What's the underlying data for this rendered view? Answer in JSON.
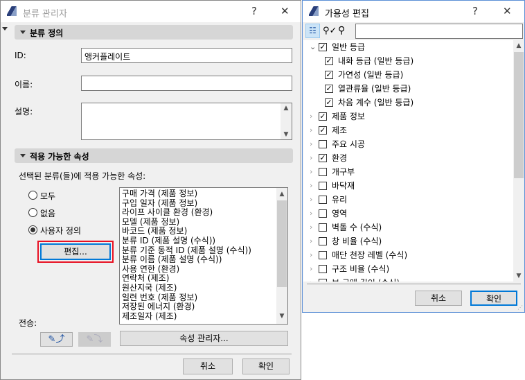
{
  "left": {
    "title": "분류 관리자",
    "help": "?",
    "close": "✕",
    "section1": "분류 정의",
    "id_label": "ID:",
    "id_value": "앵커플레이트",
    "name_label": "이름:",
    "name_value": "",
    "desc_label": "설명:",
    "desc_value": "",
    "section2": "적용 가능한 속성",
    "applicable_text": "선택된 분류(들)에 적용 가능한 속성:",
    "radios": [
      {
        "label": "모두",
        "checked": false
      },
      {
        "label": "없음",
        "checked": false
      },
      {
        "label": "사용자 정의",
        "checked": true
      }
    ],
    "edit_button": "편집...",
    "properties": [
      "구매 가격 (제품 정보)",
      "구입 일자 (제품 정보)",
      "라이프 사이클 환경 (환경)",
      "모델 (제품 정보)",
      "바코드 (제품 정보)",
      "분류 ID (제품 설명 (수식))",
      "분류 기준 동적 ID (제품 설명 (수식))",
      "분류 이름 (제품 설명 (수식))",
      "사용 연한 (환경)",
      "연락처 (제조)",
      "원산지국 (제조)",
      "일련 번호 (제품 정보)",
      "저장된 에너지 (환경)",
      "제조일자 (제조)"
    ],
    "transfer_label": "전송:",
    "property_manager_button": "속성 관리자...",
    "cancel": "취소",
    "ok": "확인"
  },
  "right": {
    "title": "가용성 편집",
    "help": "?",
    "close": "✕",
    "search_value": "",
    "items": [
      {
        "label": "일반 등급",
        "checked": true,
        "level": 0,
        "expander": "expanded"
      },
      {
        "label": "내화 등급 (일반 등급)",
        "checked": true,
        "level": 1,
        "expander": "none"
      },
      {
        "label": "가연성 (일반 등급)",
        "checked": true,
        "level": 1,
        "expander": "none"
      },
      {
        "label": "열관류율 (일반 등급)",
        "checked": true,
        "level": 1,
        "expander": "none"
      },
      {
        "label": "차음 계수 (일반 등급)",
        "checked": true,
        "level": 1,
        "expander": "none"
      },
      {
        "label": "제품 정보",
        "checked": true,
        "level": 0,
        "expander": "collapsed"
      },
      {
        "label": "제조",
        "checked": true,
        "level": 0,
        "expander": "collapsed"
      },
      {
        "label": "주요 시공",
        "checked": false,
        "level": 0,
        "expander": "collapsed"
      },
      {
        "label": "환경",
        "checked": true,
        "level": 0,
        "expander": "collapsed"
      },
      {
        "label": "개구부",
        "checked": false,
        "level": 0,
        "expander": "collapsed"
      },
      {
        "label": "바닥재",
        "checked": false,
        "level": 0,
        "expander": "collapsed"
      },
      {
        "label": "유리",
        "checked": false,
        "level": 0,
        "expander": "collapsed"
      },
      {
        "label": "영역",
        "checked": false,
        "level": 0,
        "expander": "collapsed"
      },
      {
        "label": "벽돌 수 (수식)",
        "checked": false,
        "level": 0,
        "expander": "collapsed"
      },
      {
        "label": "창 비율 (수식)",
        "checked": false,
        "level": 0,
        "expander": "collapsed"
      },
      {
        "label": "매단 천장 레벨 (수식)",
        "checked": false,
        "level": 0,
        "expander": "collapsed"
      },
      {
        "label": "구조 비율 (수식)",
        "checked": false,
        "level": 0,
        "expander": "collapsed"
      },
      {
        "label": "보 구매 길이 (수식)",
        "checked": false,
        "level": 0,
        "expander": "collapsed"
      }
    ],
    "cancel": "취소",
    "ok": "확인"
  },
  "colors": {
    "accent": "#0078d7",
    "highlight": "#e81123"
  }
}
